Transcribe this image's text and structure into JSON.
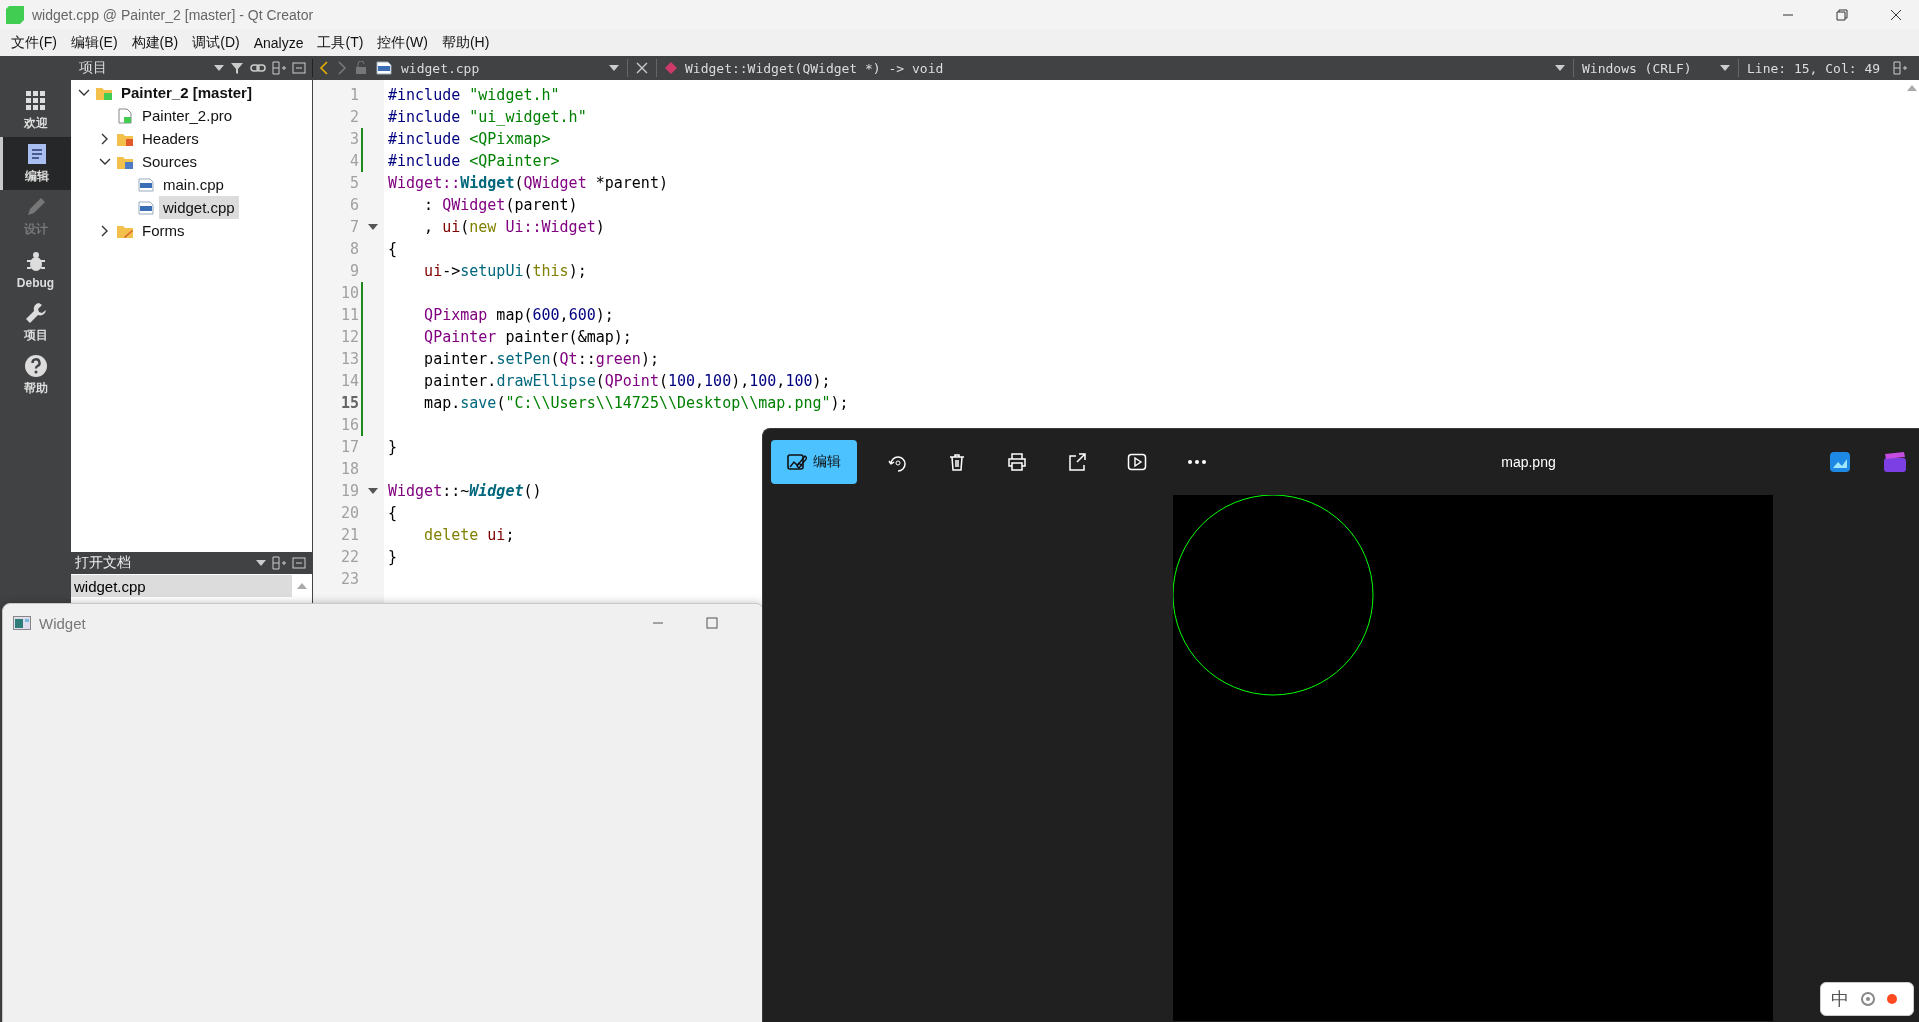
{
  "window": {
    "title": "widget.cpp @ Painter_2 [master] - Qt Creator"
  },
  "menu": [
    "文件(F)",
    "编辑(E)",
    "构建(B)",
    "调试(D)",
    "Analyze",
    "工具(T)",
    "控件(W)",
    "帮助(H)"
  ],
  "modes": [
    {
      "label": "欢迎",
      "kind": "grid",
      "selected": false,
      "disabled": false
    },
    {
      "label": "编辑",
      "kind": "document",
      "selected": true,
      "disabled": false
    },
    {
      "label": "设计",
      "kind": "pencil",
      "selected": false,
      "disabled": true
    },
    {
      "label": "Debug",
      "kind": "bug",
      "selected": false,
      "disabled": false
    },
    {
      "label": "项目",
      "kind": "wrench",
      "selected": false,
      "disabled": false
    },
    {
      "label": "帮助",
      "kind": "help",
      "selected": false,
      "disabled": false
    }
  ],
  "project_panel": {
    "title": "项目"
  },
  "tree": [
    {
      "label": "Painter_2 [master]",
      "kind": "project",
      "expanded": true,
      "selected": false,
      "children": [
        {
          "label": "Painter_2.pro",
          "kind": "pro",
          "selected": false
        },
        {
          "label": "Headers",
          "kind": "folder-h",
          "expanded": false,
          "selected": false
        },
        {
          "label": "Sources",
          "kind": "folder-cpp",
          "expanded": true,
          "selected": false,
          "children": [
            {
              "label": "main.cpp",
              "kind": "cpp",
              "selected": false
            },
            {
              "label": "widget.cpp",
              "kind": "cpp",
              "selected": true
            }
          ]
        },
        {
          "label": "Forms",
          "kind": "folder-ui",
          "expanded": false,
          "selected": false
        }
      ]
    }
  ],
  "open_documents": {
    "title": "打开文档",
    "items": [
      {
        "label": "widget.cpp",
        "selected": true
      }
    ]
  },
  "editor_toolbar": {
    "file": "widget.cpp",
    "symbol": "Widget::Widget(QWidget *) -> void",
    "line_ending": "Windows (CRLF)",
    "position": "Line: 15, Col: 49"
  },
  "code": [
    {
      "number": "1",
      "changed": false,
      "fold": false,
      "current": false,
      "tokens": [
        {
          "kind": "pre",
          "text": "#include "
        },
        {
          "kind": "str",
          "text": "\"widget.h\""
        }
      ]
    },
    {
      "number": "2",
      "changed": false,
      "fold": false,
      "current": false,
      "tokens": [
        {
          "kind": "pre",
          "text": "#include "
        },
        {
          "kind": "str",
          "text": "\"ui_widget.h\""
        }
      ]
    },
    {
      "number": "3",
      "changed": true,
      "fold": false,
      "current": false,
      "tokens": [
        {
          "kind": "pre",
          "text": "#include "
        },
        {
          "kind": "str",
          "text": "<QPixmap>"
        }
      ]
    },
    {
      "number": "4",
      "changed": true,
      "fold": false,
      "current": false,
      "tokens": [
        {
          "kind": "pre",
          "text": "#include "
        },
        {
          "kind": "str",
          "text": "<QPainter>"
        }
      ]
    },
    {
      "number": "5",
      "changed": false,
      "fold": false,
      "current": false,
      "tokens": [
        {
          "kind": "type",
          "text": "Widget::"
        },
        {
          "kind": "fn",
          "text": "Widget"
        },
        {
          "kind": "plain",
          "text": "("
        },
        {
          "kind": "type",
          "text": "QWidget"
        },
        {
          "kind": "plain",
          "text": " *parent)"
        }
      ]
    },
    {
      "number": "6",
      "changed": false,
      "fold": false,
      "current": false,
      "tokens": [
        {
          "kind": "plain",
          "text": "    : "
        },
        {
          "kind": "type",
          "text": "QWidget"
        },
        {
          "kind": "plain",
          "text": "(parent)"
        }
      ]
    },
    {
      "number": "7",
      "changed": false,
      "fold": true,
      "current": false,
      "tokens": [
        {
          "kind": "plain",
          "text": "    , "
        },
        {
          "kind": "field",
          "text": "ui"
        },
        {
          "kind": "plain",
          "text": "("
        },
        {
          "kind": "kw",
          "text": "new"
        },
        {
          "kind": "type",
          "text": " Ui::Widget"
        },
        {
          "kind": "plain",
          "text": ")"
        }
      ]
    },
    {
      "number": "8",
      "changed": false,
      "fold": false,
      "current": false,
      "tokens": [
        {
          "kind": "plain",
          "text": "{"
        }
      ]
    },
    {
      "number": "9",
      "changed": false,
      "fold": false,
      "current": false,
      "tokens": [
        {
          "kind": "field",
          "text": "    ui"
        },
        {
          "kind": "plain",
          "text": "->"
        },
        {
          "kind": "call",
          "text": "setupUi"
        },
        {
          "kind": "plain",
          "text": "("
        },
        {
          "kind": "kw",
          "text": "this"
        },
        {
          "kind": "plain",
          "text": ");"
        }
      ]
    },
    {
      "number": "10",
      "changed": true,
      "fold": false,
      "current": false
    },
    {
      "number": "11",
      "changed": true,
      "fold": false,
      "current": false,
      "tokens": [
        {
          "kind": "type",
          "text": "    QPixmap"
        },
        {
          "kind": "plain",
          "text": " map("
        },
        {
          "kind": "num",
          "text": "600"
        },
        {
          "kind": "plain",
          "text": ","
        },
        {
          "kind": "num",
          "text": "600"
        },
        {
          "kind": "plain",
          "text": ");"
        }
      ]
    },
    {
      "number": "12",
      "changed": true,
      "fold": false,
      "current": false,
      "tokens": [
        {
          "kind": "type",
          "text": "    QPainter"
        },
        {
          "kind": "plain",
          "text": " painter(&map);"
        }
      ]
    },
    {
      "number": "13",
      "changed": true,
      "fold": false,
      "current": false,
      "tokens": [
        {
          "kind": "plain",
          "text": "    painter."
        },
        {
          "kind": "call",
          "text": "setPen"
        },
        {
          "kind": "plain",
          "text": "("
        },
        {
          "kind": "type",
          "text": "Qt"
        },
        {
          "kind": "plain",
          "text": "::"
        },
        {
          "kind": "type",
          "text": "green"
        },
        {
          "kind": "plain",
          "text": ");"
        }
      ]
    },
    {
      "number": "14",
      "changed": true,
      "fold": false,
      "current": false,
      "tokens": [
        {
          "kind": "plain",
          "text": "    painter."
        },
        {
          "kind": "call",
          "text": "drawEllipse"
        },
        {
          "kind": "plain",
          "text": "("
        },
        {
          "kind": "type",
          "text": "QPoint"
        },
        {
          "kind": "plain",
          "text": "("
        },
        {
          "kind": "num",
          "text": "100"
        },
        {
          "kind": "plain",
          "text": ","
        },
        {
          "kind": "num",
          "text": "100"
        },
        {
          "kind": "plain",
          "text": "),"
        },
        {
          "kind": "num",
          "text": "100"
        },
        {
          "kind": "plain",
          "text": ","
        },
        {
          "kind": "num",
          "text": "100"
        },
        {
          "kind": "plain",
          "text": ");"
        }
      ]
    },
    {
      "number": "15",
      "changed": true,
      "fold": false,
      "current": true,
      "tokens": [
        {
          "kind": "plain",
          "text": "    map."
        },
        {
          "kind": "call",
          "text": "save"
        },
        {
          "kind": "plain",
          "text": "("
        },
        {
          "kind": "str",
          "text": "\"C:\\\\Users\\\\14725\\\\Desktop\\\\map.png\""
        },
        {
          "kind": "plain",
          "text": ");"
        }
      ]
    },
    {
      "number": "16",
      "changed": true,
      "fold": false,
      "current": false
    },
    {
      "number": "17",
      "changed": false,
      "fold": false,
      "current": false,
      "tokens": [
        {
          "kind": "plain",
          "text": "}"
        }
      ]
    },
    {
      "number": "18",
      "changed": false,
      "fold": false,
      "current": false
    },
    {
      "number": "19",
      "changed": false,
      "fold": true,
      "current": false,
      "tokens": [
        {
          "kind": "type",
          "text": "Widget"
        },
        {
          "kind": "plain",
          "text": "::~"
        },
        {
          "kind": "dtor",
          "text": "Widget"
        },
        {
          "kind": "plain",
          "text": "()"
        }
      ]
    },
    {
      "number": "20",
      "changed": false,
      "fold": false,
      "current": false,
      "tokens": [
        {
          "kind": "plain",
          "text": "{"
        }
      ]
    },
    {
      "number": "21",
      "changed": false,
      "fold": false,
      "current": false,
      "tokens": [
        {
          "kind": "kw",
          "text": "    delete"
        },
        {
          "kind": "field",
          "text": " ui"
        },
        {
          "kind": "plain",
          "text": ";"
        }
      ]
    },
    {
      "number": "22",
      "changed": false,
      "fold": false,
      "current": false,
      "tokens": [
        {
          "kind": "plain",
          "text": "}"
        }
      ]
    },
    {
      "number": "23",
      "changed": false,
      "fold": false,
      "current": false
    }
  ],
  "widget_window": {
    "title": "Widget"
  },
  "photo_viewer": {
    "edit_button": "编辑",
    "title": "map.png"
  },
  "ime": {
    "label": "中"
  }
}
